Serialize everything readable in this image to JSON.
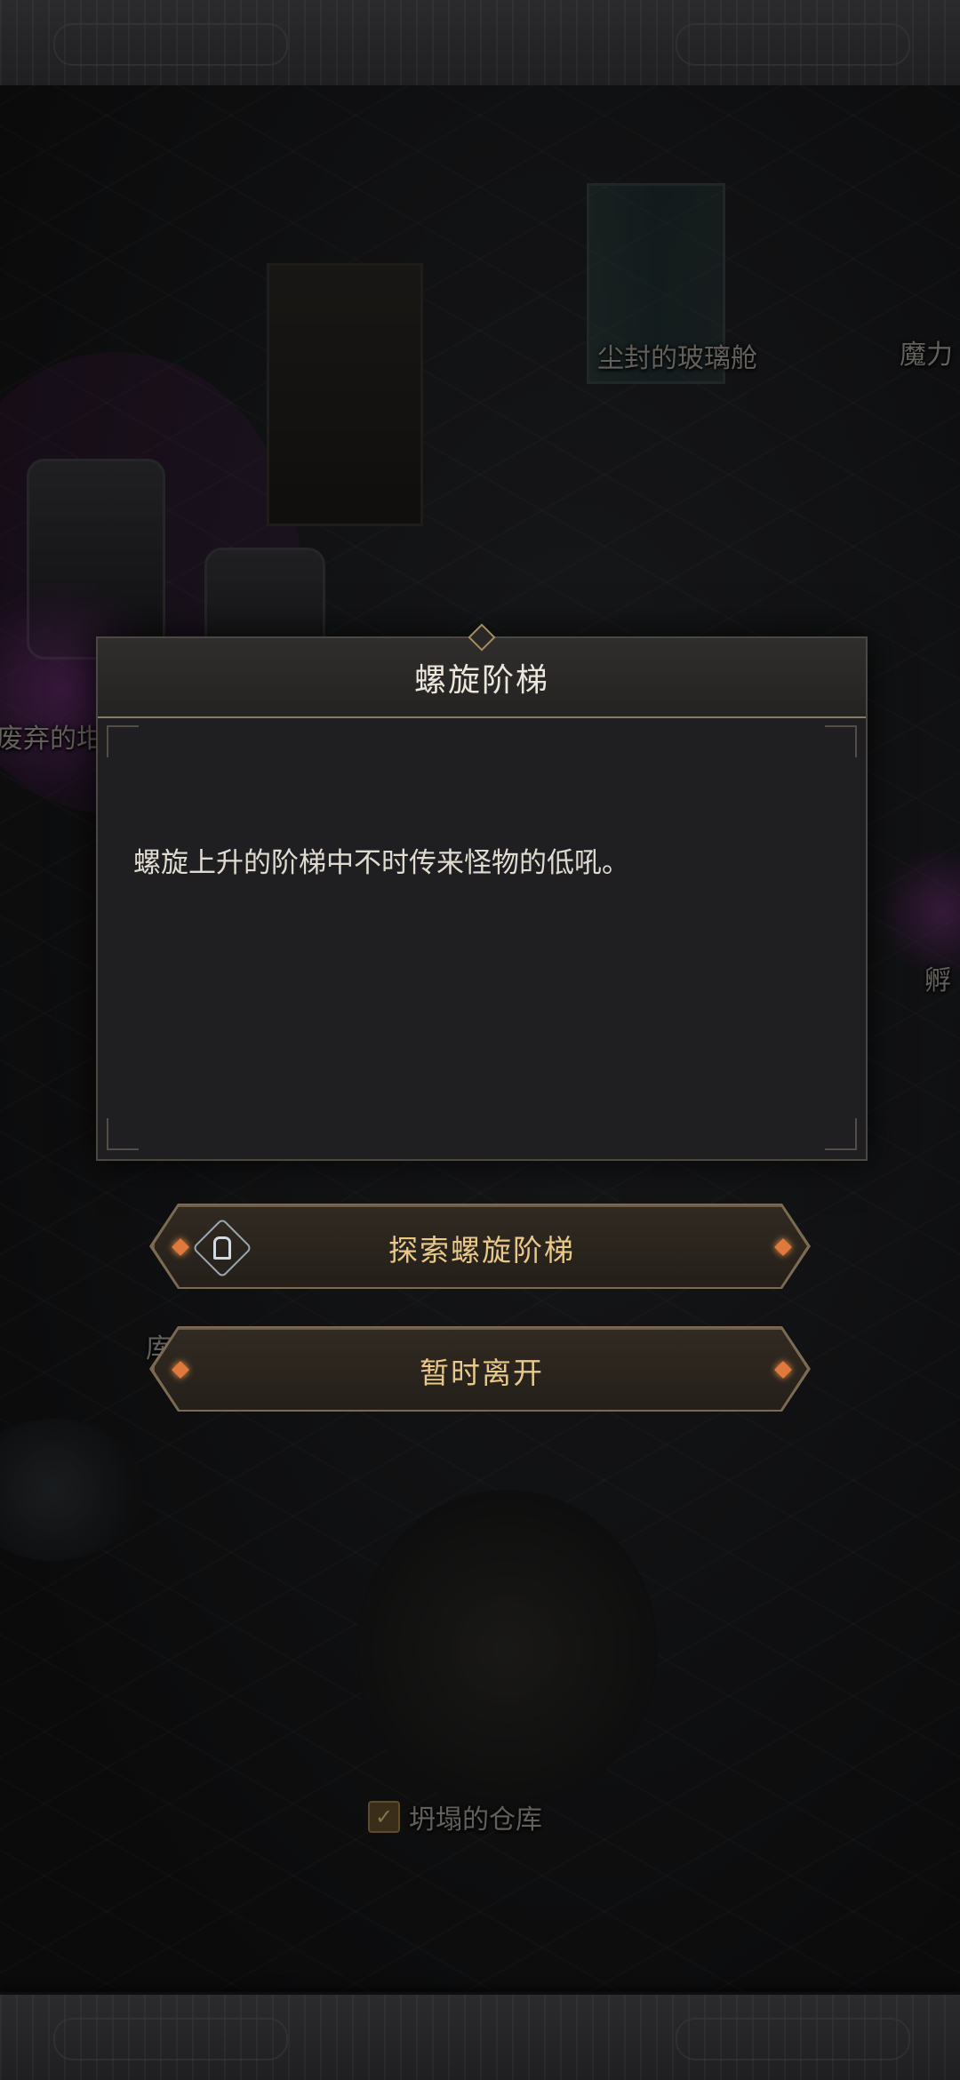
{
  "map": {
    "labels": {
      "glass_cabin": "尘封的玻璃舱",
      "magic_partial": "魔力",
      "abandoned_partial": "废弃的坩",
      "incubator_partial": "孵",
      "storage_partial": "库",
      "storage_room": "坍塌的仓库"
    }
  },
  "dialog": {
    "title": "螺旋阶梯",
    "description": "螺旋上升的阶梯中不时传来怪物的低吼。"
  },
  "actions": {
    "explore_label": "探索螺旋阶梯",
    "leave_label": "暂时离开"
  },
  "icons": {
    "check": "✓"
  }
}
